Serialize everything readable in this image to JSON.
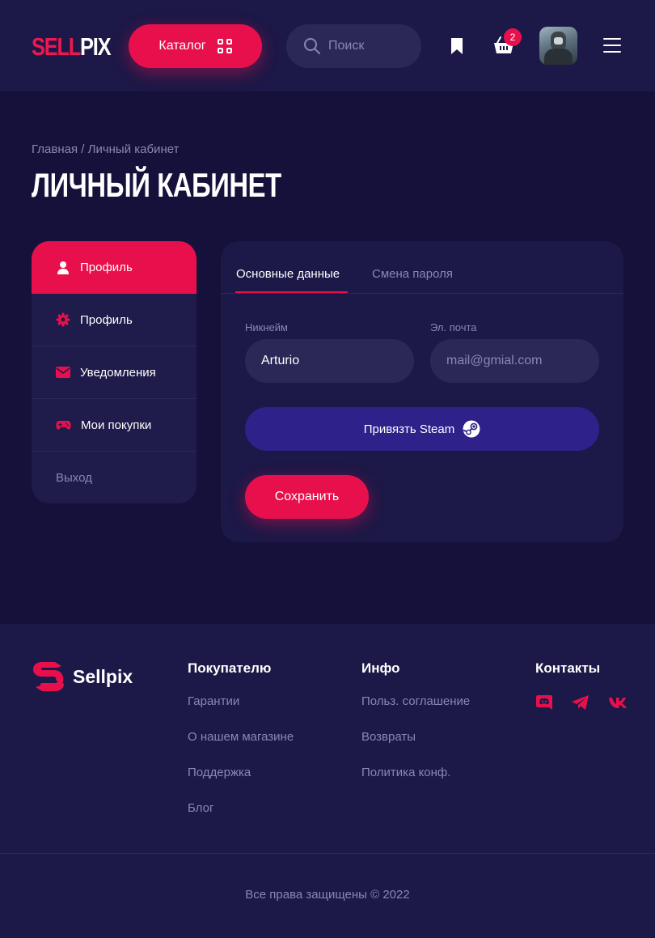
{
  "colors": {
    "background": "#15113a",
    "panel": "#1c1847",
    "input": "#2b2756",
    "accent": "#e8104c",
    "steam": "#2e218a",
    "muted_text": "#8b87b4"
  },
  "header": {
    "logo_part1": "SELL",
    "logo_part2": "PIX",
    "catalog_label": "Каталог",
    "search_placeholder": "Поиск",
    "cart_count": "2",
    "icons": [
      "search-icon",
      "bookmark-icon",
      "cart-icon",
      "avatar",
      "menu-icon",
      "grid-icon"
    ]
  },
  "breadcrumb": {
    "home": "Главная",
    "separator": "/",
    "current": "Личный кабинет"
  },
  "page_title": "ЛИЧНЫЙ КАБИНЕТ",
  "sidebar": {
    "items": [
      {
        "label": "Профиль",
        "icon": "user-icon",
        "active": true
      },
      {
        "label": "Профиль",
        "icon": "gear-icon",
        "active": false
      },
      {
        "label": "Уведомления",
        "icon": "mail-icon",
        "active": false
      },
      {
        "label": "Мои покупки",
        "icon": "gamepad-icon",
        "active": false
      }
    ],
    "logout_label": "Выход"
  },
  "profile_form": {
    "tabs": [
      {
        "label": "Основные данные",
        "active": true
      },
      {
        "label": "Смена пароля",
        "active": false
      }
    ],
    "nickname_label": "Никнейм",
    "nickname_value": "Arturio",
    "email_label": "Эл. почта",
    "email_placeholder": "mail@gmial.com",
    "steam_button_label": "Привязть Steam",
    "save_button_label": "Сохранить"
  },
  "footer": {
    "logo_text": "Sellpix",
    "buyer_heading": "Покупателю",
    "buyer_links": [
      "Гарантии",
      "О нашем магазине",
      "Поддержка",
      "Блог"
    ],
    "info_heading": "Инфо",
    "info_links": [
      "Польз. соглашение",
      "Возвраты",
      "Политика конф."
    ],
    "contacts_heading": "Контакты",
    "social_icons": [
      "discord-icon",
      "telegram-icon",
      "vk-icon"
    ],
    "copyright": "Все права защищены © 2022"
  }
}
